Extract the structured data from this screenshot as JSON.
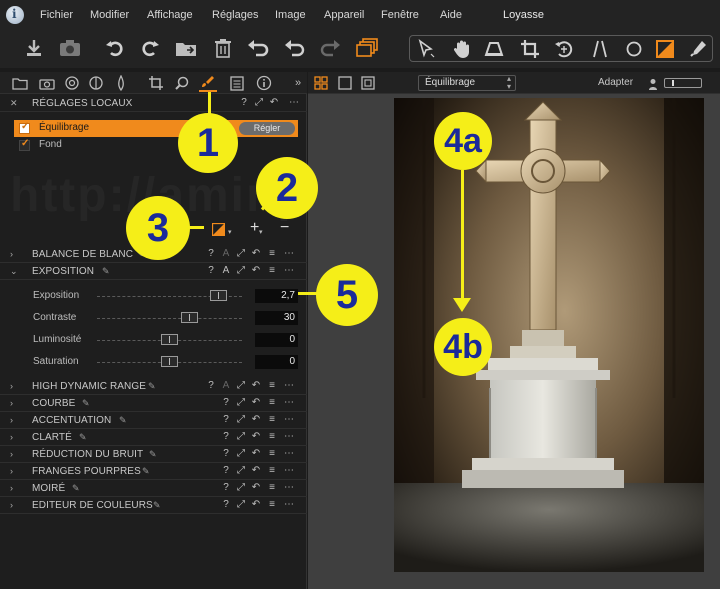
{
  "menubar": {
    "items": [
      "Fichier",
      "Modifier",
      "Affichage",
      "Réglages",
      "Image",
      "Appareil",
      "Fenêtre",
      "Aide"
    ],
    "window_title": "Loyasse"
  },
  "local_adjustments": {
    "title": "RÉGLAGES LOCAUX",
    "layers": [
      {
        "name": "Équilibrage",
        "active": true,
        "button": "Régler"
      },
      {
        "name": "Fond",
        "active": false
      }
    ]
  },
  "sections": {
    "white_balance": "BALANCE DE BLANC",
    "exposure": "EXPOSITION",
    "hdr": "HIGH DYNAMIC RANGE",
    "curve": "COURBE",
    "sharpening": "ACCENTUATION",
    "clarity": "CLARTÉ",
    "noise_reduction": "RÉDUCTION DU BRUIT",
    "purple_fringing": "FRANGES POURPRES",
    "moire": "MOIRÉ",
    "color_editor": "EDITEUR DE COULEURS"
  },
  "exposure_sliders": [
    {
      "label": "Exposition",
      "value": "2,7",
      "position": 0.83
    },
    {
      "label": "Contraste",
      "value": "30",
      "position": 0.62
    },
    {
      "label": "Luminosité",
      "value": "0",
      "position": 0.5
    },
    {
      "label": "Saturation",
      "value": "0",
      "position": 0.5
    }
  ],
  "viewer": {
    "variant": "Équilibrage",
    "fit_label": "Adapter"
  },
  "watermark": "http://aminp",
  "callouts": [
    "1",
    "2",
    "3",
    "4a",
    "4b",
    "5"
  ],
  "colors": {
    "accent": "#f08a1c",
    "callout_fill": "#f5ee18",
    "callout_text": "#1a2a9a"
  }
}
